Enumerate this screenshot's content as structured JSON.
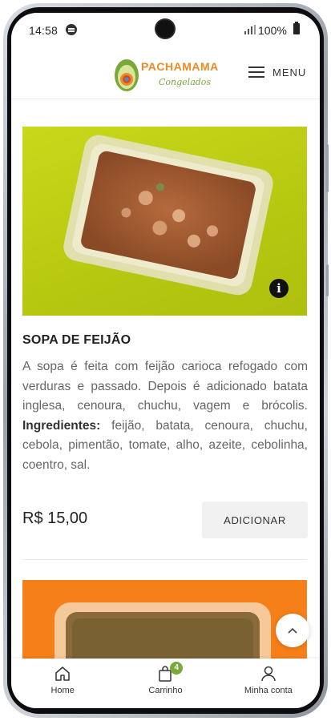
{
  "status_bar": {
    "time": "14:58",
    "battery": "100%"
  },
  "header": {
    "logo_text": "PACHAMAMA",
    "logo_subtext": "Congelados",
    "menu_label": "MENU"
  },
  "product": {
    "title": "SOPA DE FEIJÃO",
    "description": "A sopa é feita com feijão carioca refogado com verduras e passado. Depois é adicionado batata inglesa, cenoura, chuchu, vagem e brócolis.",
    "ingredients_label": "Ingredientes:",
    "ingredients": " feijão, batata, cenoura, chuchu, cebola, pimentão, tomate, alho, azeite, cebolinha, coentro, sal.",
    "price": "R$ 15,00",
    "add_button": "ADICIONAR"
  },
  "bottom_nav": {
    "items": [
      {
        "label": "Home",
        "icon": "home-icon"
      },
      {
        "label": "Carrinho",
        "icon": "cart-icon",
        "badge": "4"
      },
      {
        "label": "Minha conta",
        "icon": "user-icon"
      }
    ]
  },
  "colors": {
    "product_bg_1": "#bccc12",
    "product_bg_2": "#f57f18",
    "brand_orange": "#f08a24",
    "brand_green": "#79a83b",
    "badge_green": "#79a83b"
  }
}
